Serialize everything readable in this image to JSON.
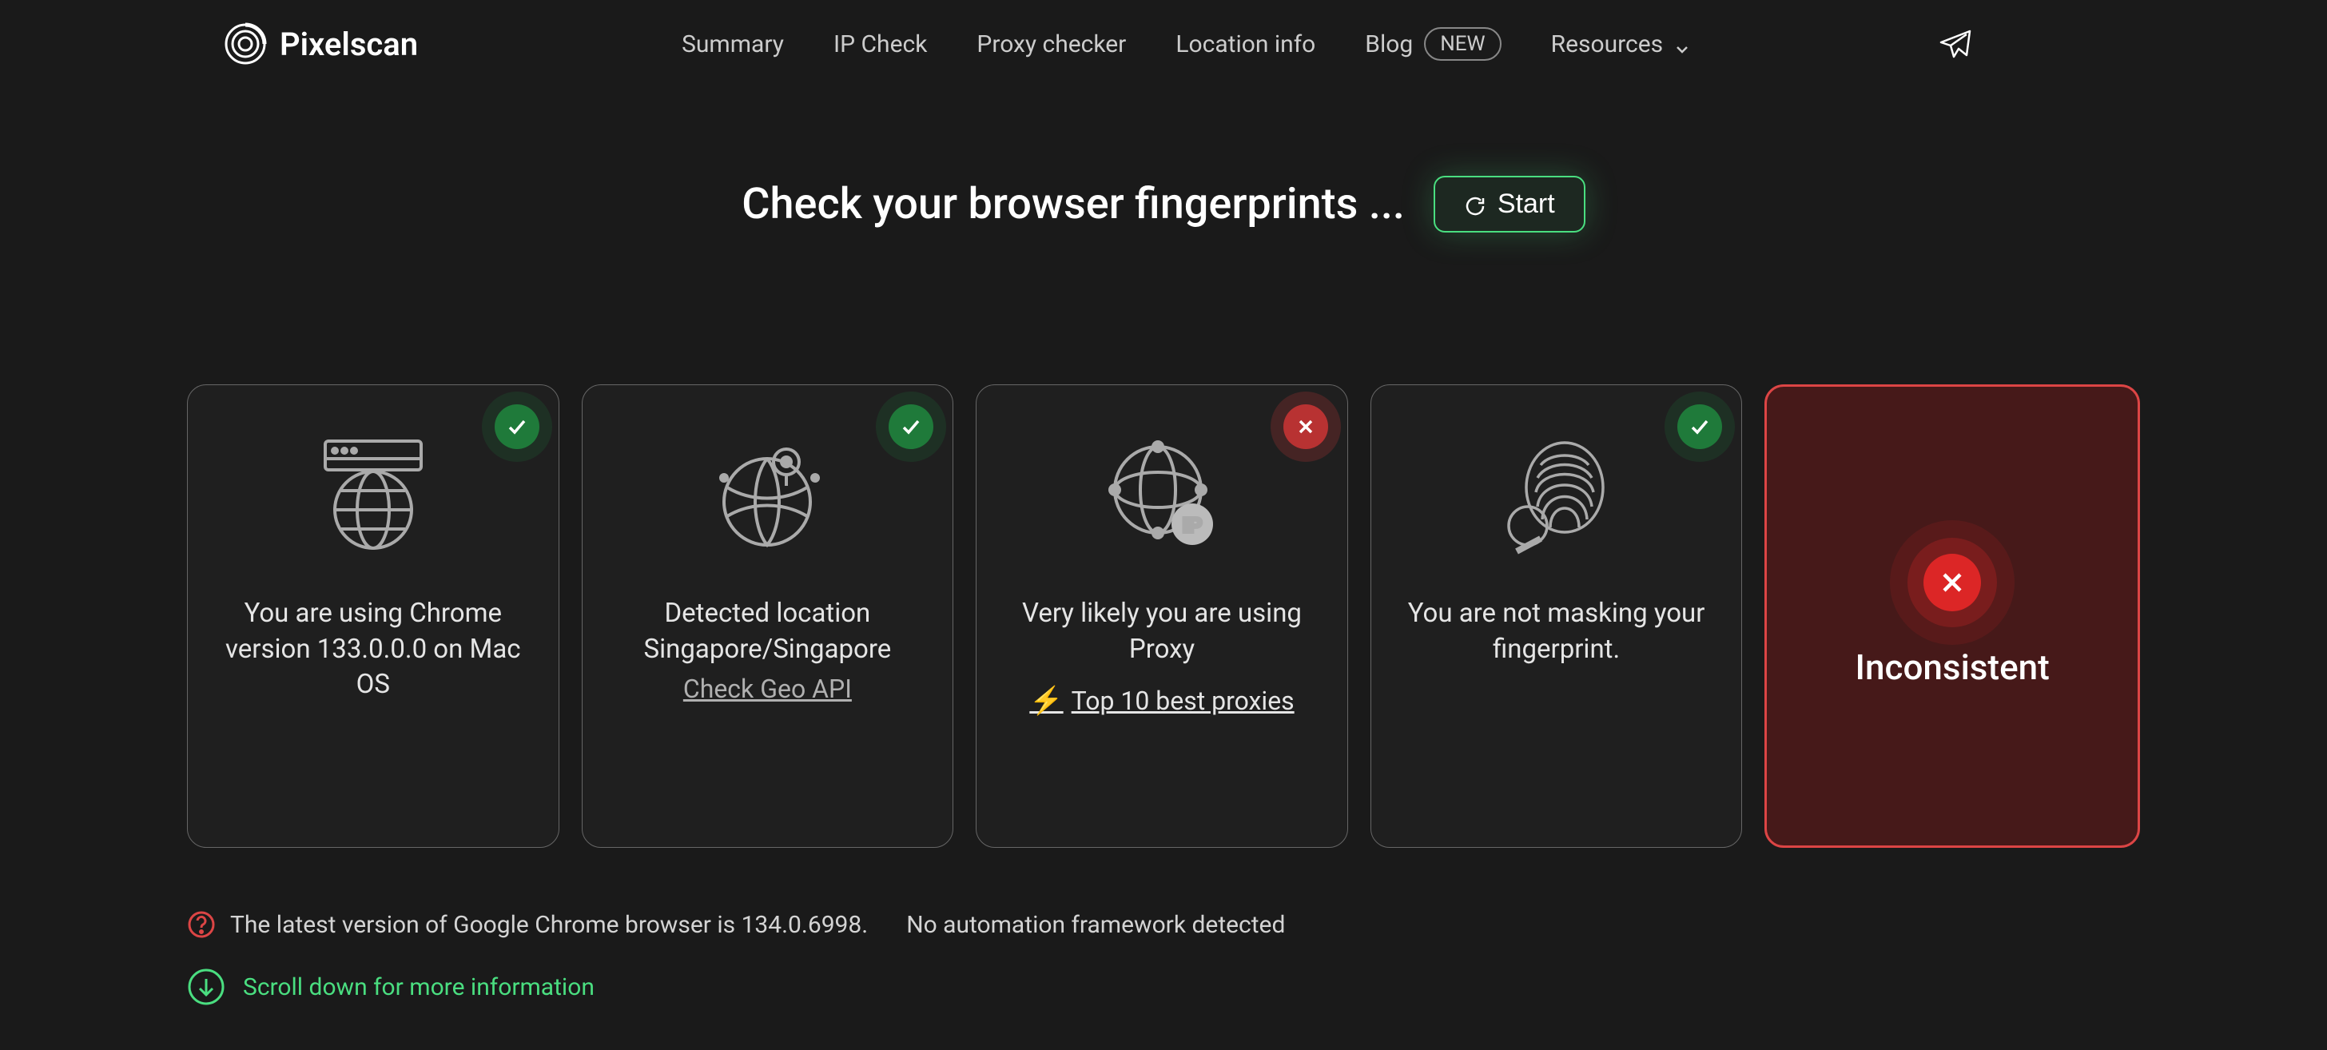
{
  "brand": {
    "name": "Pixelscan"
  },
  "nav": {
    "items": [
      "Summary",
      "IP Check",
      "Proxy checker",
      "Location info",
      "Blog",
      "Resources"
    ],
    "blog_badge": "NEW"
  },
  "hero": {
    "title": "Check your browser fingerprints ...",
    "start_label": "Start"
  },
  "cards": {
    "browser": {
      "status": "ok",
      "text": "You are using Chrome version 133.0.0.0 on Mac OS"
    },
    "location": {
      "status": "ok",
      "text": "Detected location Singapore/Singapore",
      "link": "Check Geo API"
    },
    "proxy": {
      "status": "fail",
      "text": "Very likely you are using Proxy",
      "link": "Top 10 best proxies"
    },
    "fingerprint": {
      "status": "ok",
      "text": "You are not masking your fingerprint."
    },
    "result": {
      "status": "fail",
      "title": "Inconsistent"
    }
  },
  "info": {
    "version_warning": "The latest version of Google Chrome browser is 134.0.6998.",
    "automation": "No automation framework detected"
  },
  "scroll": {
    "label": "Scroll down for more information"
  }
}
